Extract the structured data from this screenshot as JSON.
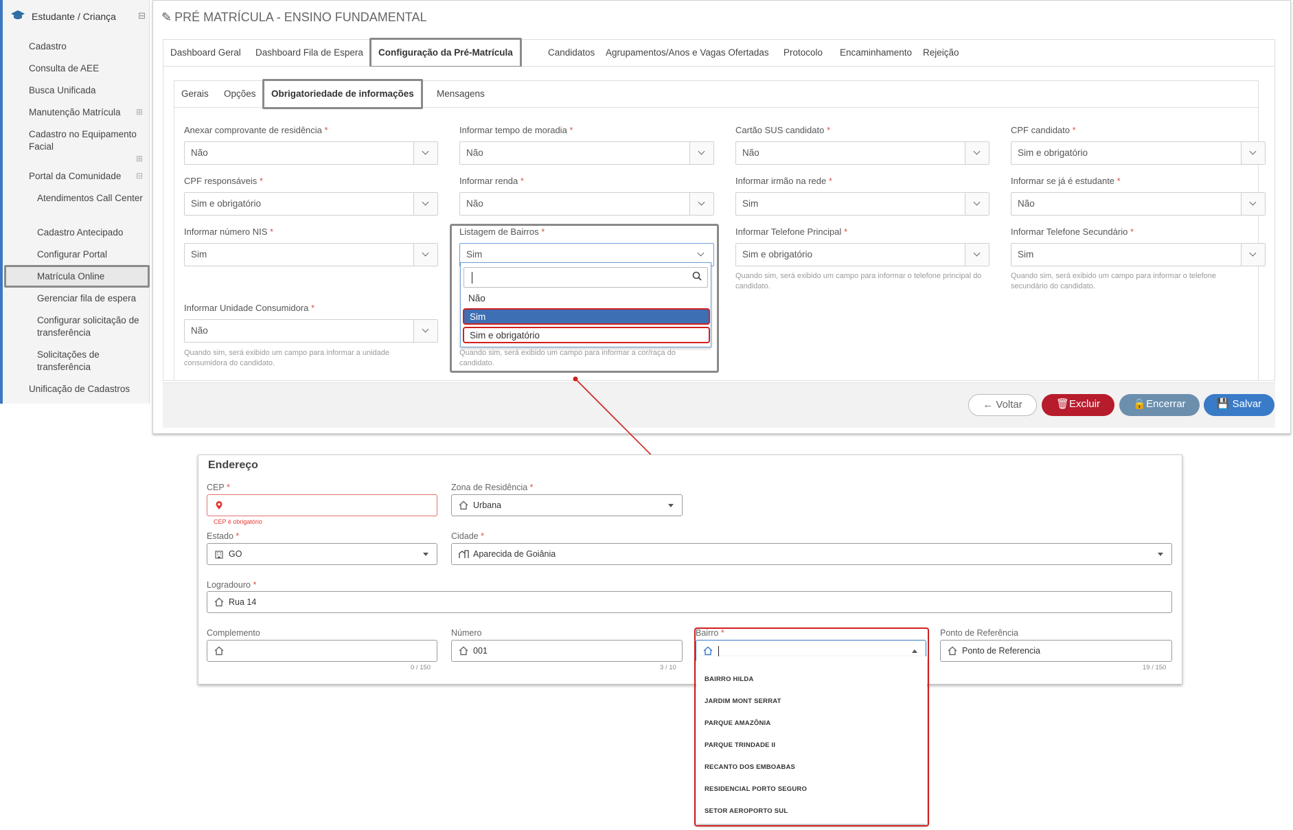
{
  "sidebar": {
    "section_title": "Estudante / Criança",
    "items": [
      {
        "label": "Cadastro"
      },
      {
        "label": "Consulta de AEE"
      },
      {
        "label": "Busca Unificada"
      },
      {
        "label": "Manutenção Matrícula"
      },
      {
        "label": "Cadastro no Equipamento Facial"
      },
      {
        "label": "Portal da Comunidade"
      },
      {
        "label": "Atendimentos Call Center"
      },
      {
        "label": "Cadastro Antecipado"
      },
      {
        "label": "Configurar Portal"
      },
      {
        "label": "Matrícula Online",
        "active": true
      },
      {
        "label": "Gerenciar fila de espera"
      },
      {
        "label": "Configurar solicitação de transferência"
      },
      {
        "label": "Solicitações de transferência"
      },
      {
        "label": "Unificação de Cadastros"
      }
    ]
  },
  "page": {
    "title": "PRÉ MATRÍCULA - ENSINO FUNDAMENTAL"
  },
  "main_tabs": [
    {
      "label": "Dashboard Geral"
    },
    {
      "label": "Dashboard Fila de Espera"
    },
    {
      "label": "Configuração da Pré-Matrícula",
      "active": true
    },
    {
      "label": "Candidatos"
    },
    {
      "label": "Agrupamentos/Anos e Vagas Ofertadas"
    },
    {
      "label": "Protocolo"
    },
    {
      "label": "Encaminhamento"
    },
    {
      "label": "Rejeição"
    }
  ],
  "sub_tabs": [
    {
      "label": "Gerais"
    },
    {
      "label": "Opções"
    },
    {
      "label": "Obrigatoriedade de informações",
      "active": true
    },
    {
      "label": "Mensagens"
    }
  ],
  "fields": [
    {
      "label": "Anexar comprovante de residência",
      "value": "Não"
    },
    {
      "label": "Informar tempo de moradia",
      "value": "Não"
    },
    {
      "label": "Cartão SUS candidato",
      "value": "Não"
    },
    {
      "label": "CPF candidato",
      "value": "Sim e obrigatório"
    },
    {
      "label": "CPF responsáveis",
      "value": "Sim e obrigatório"
    },
    {
      "label": "Informar renda",
      "value": "Não"
    },
    {
      "label": "Informar irmão na rede",
      "value": "Sim"
    },
    {
      "label": "Informar se já é estudante",
      "value": "Não"
    },
    {
      "label": "Informar número NIS",
      "value": "Sim"
    },
    {
      "label": "Listagem de Bairros",
      "value": "Sim"
    },
    {
      "label": "Informar Telefone Principal",
      "value": "Sim e obrigatório",
      "help": "Quando sim, será exibido um campo para informar o telefone principal do candidato."
    },
    {
      "label": "Informar Telefone Secundário",
      "value": "Sim",
      "help": "Quando sim, será exibido um campo para informar o telefone secundário do candidato."
    },
    {
      "label": "Informar Unidade Consumidora",
      "value": "Não",
      "help": "Quando sim, será exibido um campo para informar a unidade consumidora do candidato."
    }
  ],
  "hidden_help": "Quando sim, será exibido um campo para informar a cor/raça do candidato.",
  "dropdown": {
    "search_value": "",
    "options": [
      "Não",
      "Sim",
      "Sim e obrigatório"
    ],
    "highlighted": "Sim"
  },
  "actions": {
    "back": "Voltar",
    "delete": "Excluir",
    "close": "Encerrar",
    "save": "Salvar"
  },
  "colors": {
    "primary": "#3a7bc8",
    "danger": "#b71c2c",
    "secondary": "#6c8fae",
    "highlight_red": "#d02020",
    "sidebar_accent": "#3c78c0"
  },
  "address": {
    "title": "Endereço",
    "cep": {
      "label": "CEP",
      "value": "",
      "error": "CEP é obrigatório"
    },
    "zona": {
      "label": "Zona de Residência",
      "value": "Urbana"
    },
    "estado": {
      "label": "Estado",
      "value": "GO"
    },
    "cidade": {
      "label": "Cidade",
      "value": "Aparecida de Goiânia"
    },
    "logradouro": {
      "label": "Logradouro",
      "value": "Rua 14"
    },
    "complemento": {
      "label": "Complemento",
      "value": "",
      "counter": "0 / 150"
    },
    "numero": {
      "label": "Número",
      "value": "001",
      "counter": "3 / 10"
    },
    "bairro": {
      "label": "Bairro",
      "value": ""
    },
    "referencia": {
      "label": "Ponto de Referência",
      "value": "Ponto de Referencia",
      "counter": "19 / 150"
    },
    "bairro_options": [
      "BAIRRO HILDA",
      "JARDIM MONT SERRAT",
      "PARQUE AMAZÔNIA",
      "PARQUE TRINDADE II",
      "RECANTO DOS EMBOABAS",
      "RESIDENCIAL PORTO SEGURO",
      "SETOR AEROPORTO SUL"
    ]
  }
}
